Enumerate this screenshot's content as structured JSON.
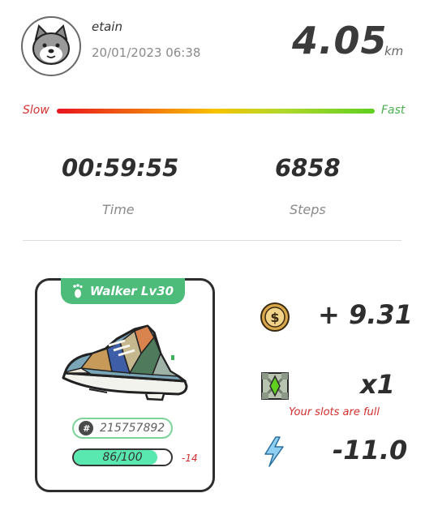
{
  "user": {
    "name": "etain",
    "datetime": "20/01/2023 06:38",
    "avatar": "shiba-dog-avatar"
  },
  "run": {
    "distance": "4.05",
    "unit": "km",
    "time": "00:59:55",
    "time_label": "Time",
    "steps": "6858",
    "steps_label": "Steps"
  },
  "speed": {
    "slow_label": "Slow",
    "fast_label": "Fast",
    "colors": [
      "#e8141e",
      "#f7c300",
      "#5fcf22"
    ]
  },
  "sneaker": {
    "type_label": "Walker Lv30",
    "type_icon": "footprint-icon",
    "id": "215757892",
    "id_icon": "hash-icon",
    "durability_text": "86/100",
    "durability_value": 86,
    "durability_max": 100,
    "durability_change": "-14"
  },
  "rewards": {
    "coin_icon": "gst-coin-icon",
    "coin_value": "+ 9.31",
    "box_icon": "mystery-box-icon",
    "box_value": "x1",
    "slots_note": "Your slots are full",
    "energy_icon": "lightning-icon",
    "energy_value": "-11.0"
  },
  "colors": {
    "accent_green": "#4dbb7a",
    "negative_red": "#d32f2f",
    "durability_fill": "#59e8b0"
  }
}
